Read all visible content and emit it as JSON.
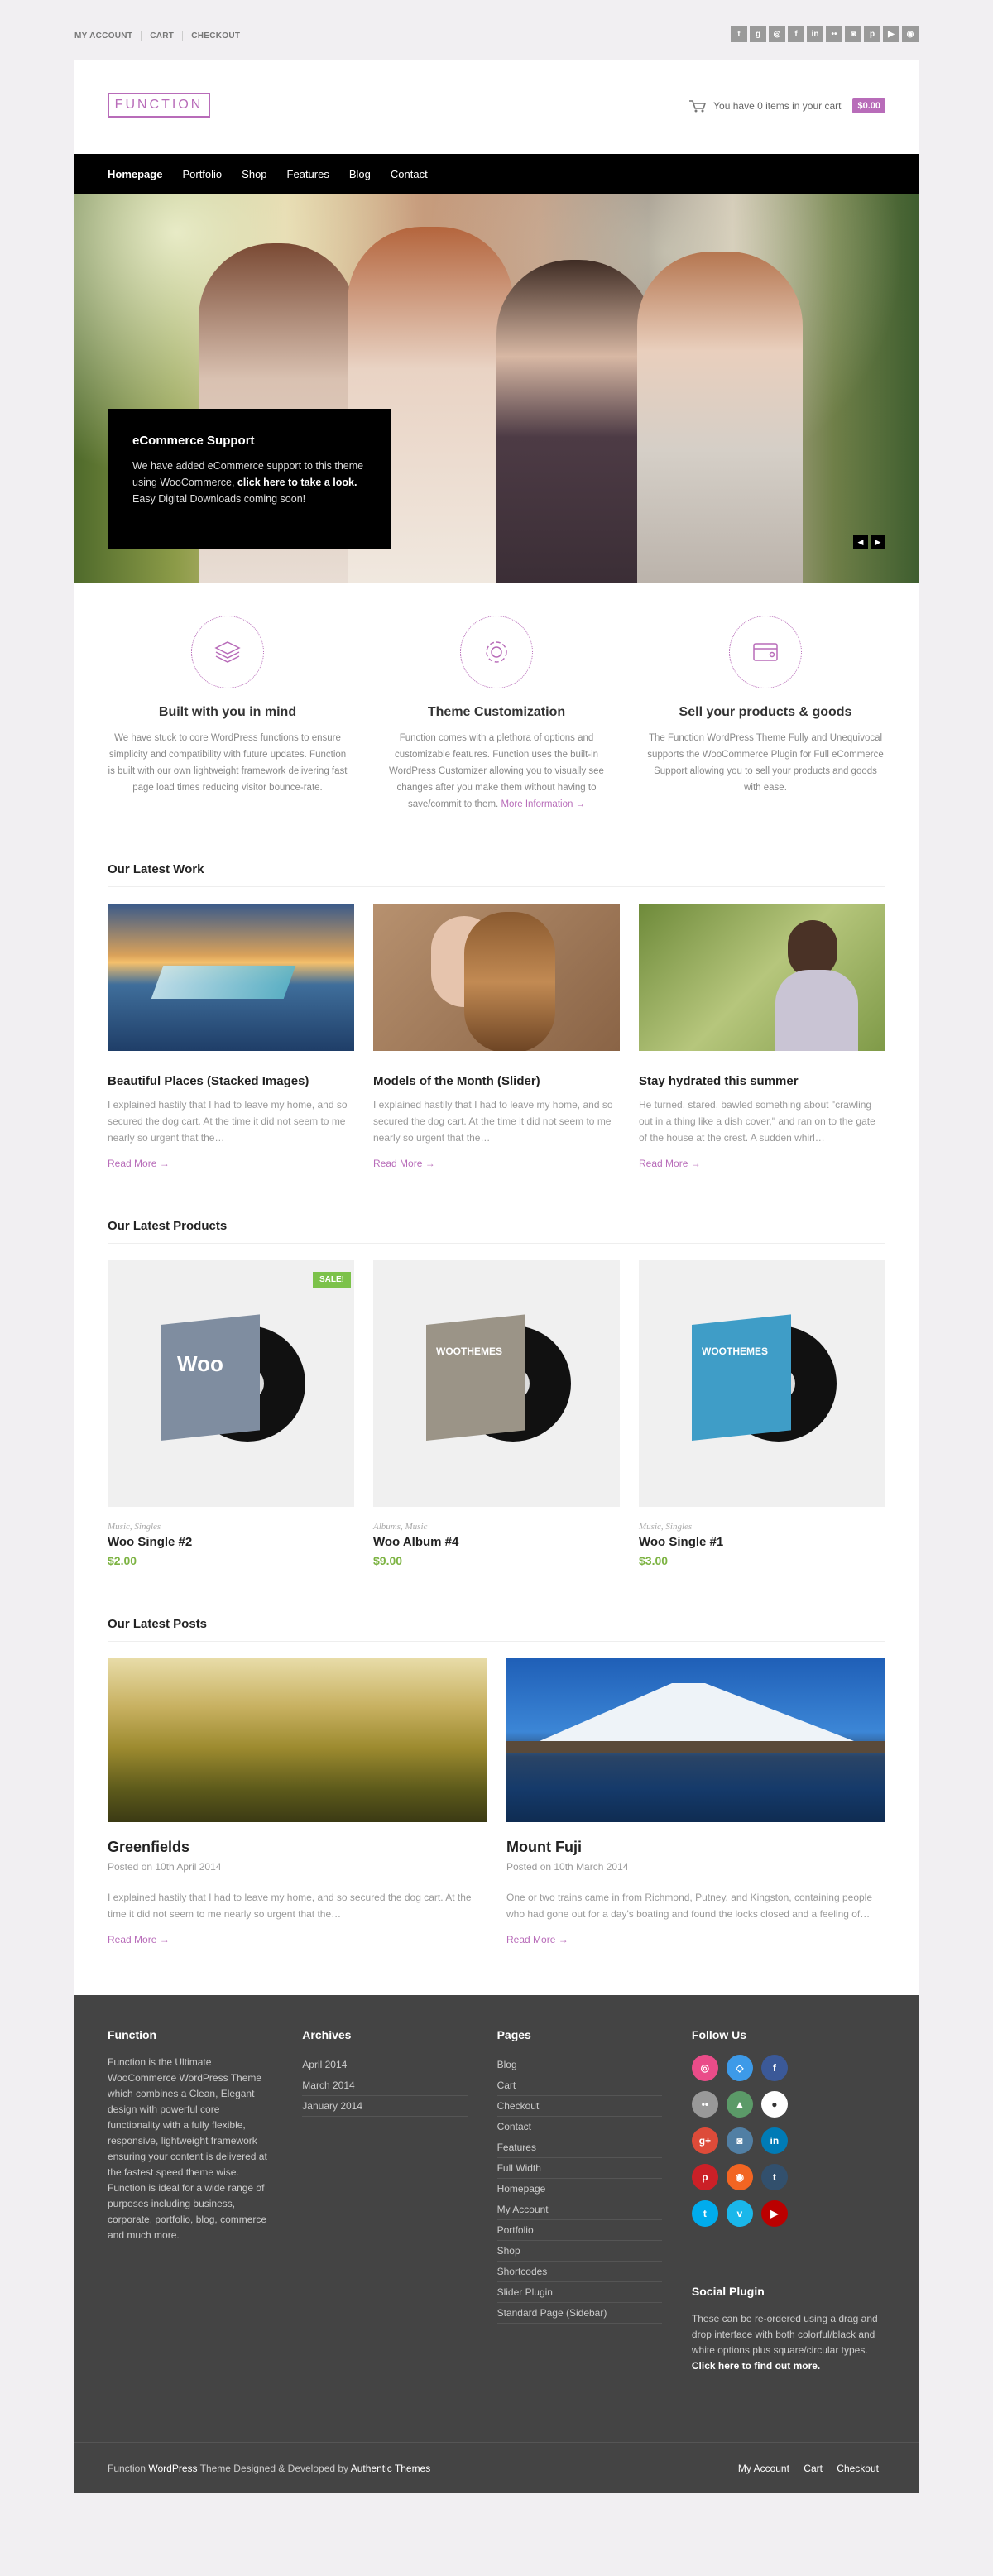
{
  "top": {
    "links": [
      "MY ACCOUNT",
      "CART",
      "CHECKOUT"
    ],
    "social_icons": [
      "twitter-icon",
      "googleplus-icon",
      "dribbble-icon",
      "facebook-icon",
      "linkedin-icon",
      "flickr-icon",
      "instagram-icon",
      "pinterest-icon",
      "youtube-icon",
      "rss-icon"
    ],
    "social_glyphs": [
      "t",
      "g",
      "◎",
      "f",
      "in",
      "••",
      "◙",
      "p",
      "▶",
      "◉"
    ]
  },
  "header": {
    "logo": "FUNCTION",
    "cart_text": "You have 0 items in your cart",
    "cart_total": "$0.00"
  },
  "nav": [
    "Homepage",
    "Portfolio",
    "Shop",
    "Features",
    "Blog",
    "Contact"
  ],
  "hero": {
    "title": "eCommerce Support",
    "text_before": "We have added eCommerce support to this theme using WooCommerce, ",
    "link": "click here to take a look.",
    "text_after": " Easy Digital Downloads coming soon!"
  },
  "features": [
    {
      "title": "Built with you in mind",
      "text": "We have stuck to core WordPress functions to ensure simplicity and compatibility with future updates. Function is built with our own lightweight framework delivering fast page load times reducing visitor bounce-rate.",
      "link": ""
    },
    {
      "title": "Theme Customization",
      "text": "Function comes with a plethora of options and customizable features. Function uses the built-in WordPress Customizer allowing you to visually see changes after you make them without having to save/commit to them.",
      "link": "More Information →"
    },
    {
      "title": "Sell your products & goods",
      "text": "The Function WordPress Theme Fully and Unequivocal supports the WooCommerce Plugin for Full eCommerce Support allowing you to sell your products and goods with ease.",
      "link": ""
    }
  ],
  "work": {
    "title": "Our Latest Work",
    "read_more": "Read More →",
    "items": [
      {
        "title": "Beautiful Places (Stacked Images)",
        "text": "I explained hastily that I had to leave my home, and so secured the dog cart. At the time it did not seem to me nearly so urgent that the…"
      },
      {
        "title": "Models of the Month (Slider)",
        "text": "I explained hastily that I had to leave my home, and so secured the dog cart. At the time it did not seem to me nearly so urgent that the…"
      },
      {
        "title": "Stay hydrated this summer",
        "text": "He turned, stared, bawled something about \"crawling out in a thing like a dish cover,\" and ran on to the gate of the house at the crest. A sudden whirl…"
      }
    ]
  },
  "products": {
    "title": "Our Latest Products",
    "sale": "SALE!",
    "items": [
      {
        "cats": "Music, Singles",
        "name": "Woo Single #2",
        "price": "$2.00",
        "cover": "Woo"
      },
      {
        "cats": "Albums, Music",
        "name": "Woo Album #4",
        "price": "$9.00",
        "cover": "WOOTHEMES"
      },
      {
        "cats": "Music, Singles",
        "name": "Woo Single #1",
        "price": "$3.00",
        "cover": "WOOTHEMES"
      }
    ]
  },
  "posts": {
    "title": "Our Latest Posts",
    "read_more": "Read More →",
    "items": [
      {
        "title": "Greenfields",
        "date": "Posted on 10th April 2014",
        "text": "I explained hastily that I had to leave my home, and so secured the dog cart. At the time it did not seem to me nearly so urgent that the…"
      },
      {
        "title": "Mount Fuji",
        "date": "Posted on 10th March 2014",
        "text": "One or two trains came in from Richmond, Putney, and Kingston, containing people who had gone out for a day's boating and found the locks closed and a feeling of…"
      }
    ]
  },
  "footer": {
    "function_title": "Function",
    "function_text": "Function is the Ultimate WooCommerce WordPress Theme which combines a Clean, Elegant design with powerful core functionality with a fully flexible, responsive, lightweight framework ensuring your content is delivered at the fastest speed theme wise. Function is ideal for a wide range of purposes including business, corporate, portfolio, blog, commerce and much more.",
    "archives_title": "Archives",
    "archives": [
      "April 2014",
      "March 2014",
      "January 2014"
    ],
    "pages_title": "Pages",
    "pages": [
      "Blog",
      "Cart",
      "Checkout",
      "Contact",
      "Features",
      "Full Width",
      "Homepage",
      "My Account",
      "Portfolio",
      "Shop",
      "Shortcodes",
      "Slider Plugin",
      "Standard Page (Sidebar)"
    ],
    "follow_title": "Follow Us",
    "follow_icons": [
      {
        "name": "dribbble-icon",
        "glyph": "◎",
        "color": "#ea4c89"
      },
      {
        "name": "dropbox-icon",
        "glyph": "◇",
        "color": "#3d9ae8"
      },
      {
        "name": "facebook-icon",
        "glyph": "f",
        "color": "#3b5998"
      },
      {
        "name": "flickr-icon",
        "glyph": "••",
        "color": "#999999"
      },
      {
        "name": "forrst-icon",
        "glyph": "▲",
        "color": "#5b9a68"
      },
      {
        "name": "github-icon",
        "glyph": "●",
        "color": "#ffffff"
      },
      {
        "name": "googleplus-icon",
        "glyph": "g+",
        "color": "#dd4b39"
      },
      {
        "name": "instagram-icon",
        "glyph": "◙",
        "color": "#517fa4"
      },
      {
        "name": "linkedin-icon",
        "glyph": "in",
        "color": "#007bb6"
      },
      {
        "name": "pinterest-icon",
        "glyph": "p",
        "color": "#cb2027"
      },
      {
        "name": "rss-icon",
        "glyph": "◉",
        "color": "#f26522"
      },
      {
        "name": "tumblr-icon",
        "glyph": "t",
        "color": "#32506d"
      },
      {
        "name": "twitter-icon",
        "glyph": "t",
        "color": "#00aced"
      },
      {
        "name": "vimeo-icon",
        "glyph": "v",
        "color": "#1ab7ea"
      },
      {
        "name": "youtube-icon",
        "glyph": "▶",
        "color": "#bb0000"
      }
    ],
    "plugin_title": "Social Plugin",
    "plugin_text": "These can be re-ordered using a drag and drop interface with both colorful/black and white options plus square/circular types.",
    "plugin_link": "Click here to find out more."
  },
  "bottom": {
    "left_1": "Function ",
    "left_wp": "WordPress",
    "left_2": " Theme Designed & Developed by ",
    "left_author": "Authentic Themes",
    "links": [
      "My Account",
      "Cart",
      "Checkout"
    ]
  },
  "colors": {
    "accent": "#b86cb9",
    "price": "#7cb342",
    "sale": "#7cc24a",
    "footer": "#444444"
  }
}
